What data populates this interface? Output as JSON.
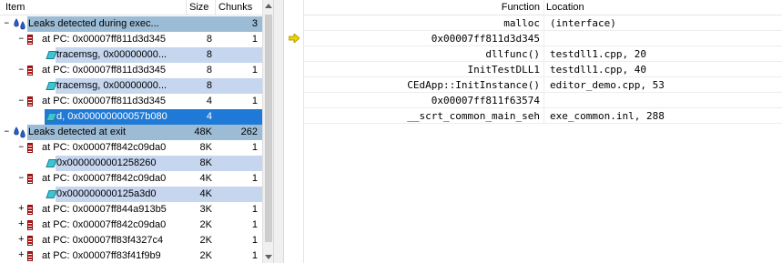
{
  "left_pane": {
    "headers": {
      "item": "Item",
      "size": "Size",
      "chunks": "Chunks"
    },
    "rows": [
      {
        "kind": "group",
        "expander": "–",
        "label": "Leaks detected during exec...",
        "size": "",
        "chunks": "3",
        "style": "group"
      },
      {
        "kind": "stack",
        "expander": "–",
        "label": "at PC: 0x00007ff811d3d345",
        "size": "8",
        "chunks": "1",
        "style": "plain"
      },
      {
        "kind": "block",
        "expander": "",
        "label": "tracemsg, 0x00000000...",
        "size": "8",
        "chunks": "",
        "style": "light"
      },
      {
        "kind": "stack",
        "expander": "–",
        "label": "at PC: 0x00007ff811d3d345",
        "size": "8",
        "chunks": "1",
        "style": "plain"
      },
      {
        "kind": "block",
        "expander": "",
        "label": "tracemsg, 0x00000000...",
        "size": "8",
        "chunks": "",
        "style": "light"
      },
      {
        "kind": "stack",
        "expander": "–",
        "label": "at PC: 0x00007ff811d3d345",
        "size": "4",
        "chunks": "1",
        "style": "plain"
      },
      {
        "kind": "block",
        "expander": "",
        "label": "d, 0x000000000057b080",
        "size": "4",
        "chunks": "",
        "style": "selected"
      },
      {
        "kind": "group",
        "expander": "–",
        "label": "Leaks detected at exit",
        "size": "48K",
        "chunks": "262",
        "style": "group"
      },
      {
        "kind": "stack",
        "expander": "–",
        "label": "at PC: 0x00007ff842c09da0",
        "size": "8K",
        "chunks": "1",
        "style": "plain"
      },
      {
        "kind": "block",
        "expander": "",
        "label": "0x0000000001258260",
        "size": "8K",
        "chunks": "",
        "style": "light"
      },
      {
        "kind": "stack",
        "expander": "–",
        "label": "at PC: 0x00007ff842c09da0",
        "size": "4K",
        "chunks": "1",
        "style": "plain"
      },
      {
        "kind": "block",
        "expander": "",
        "label": "0x000000000125a3d0",
        "size": "4K",
        "chunks": "",
        "style": "light"
      },
      {
        "kind": "stack",
        "expander": "+",
        "label": "at PC: 0x00007ff844a913b5",
        "size": "3K",
        "chunks": "1",
        "style": "plain"
      },
      {
        "kind": "stack",
        "expander": "+",
        "label": "at PC: 0x00007ff842c09da0",
        "size": "2K",
        "chunks": "1",
        "style": "plain"
      },
      {
        "kind": "stack",
        "expander": "+",
        "label": "at PC: 0x00007ff83f4327c4",
        "size": "2K",
        "chunks": "1",
        "style": "plain"
      },
      {
        "kind": "stack",
        "expander": "+",
        "label": "at PC: 0x00007ff83f41f9b9",
        "size": "2K",
        "chunks": "1",
        "style": "plain"
      }
    ]
  },
  "right_pane": {
    "headers": {
      "function": "Function",
      "location": "Location"
    },
    "rows": [
      {
        "function": "malloc",
        "location": "(interface)",
        "current": false
      },
      {
        "function": "0x00007ff811d3d345",
        "location": "",
        "current": true
      },
      {
        "function": "dllfunc()",
        "location": "testdll1.cpp, 20",
        "current": false
      },
      {
        "function": "InitTestDLL1",
        "location": "testdll1.cpp, 40",
        "current": false
      },
      {
        "function": "CEdApp::InitInstance()",
        "location": "editor_demo.cpp, 53",
        "current": false
      },
      {
        "function": "0x00007ff811f63574",
        "location": "",
        "current": false
      },
      {
        "function": "__scrt_common_main_seh",
        "location": "exe_common.inl, 288",
        "current": false
      }
    ]
  },
  "icons": {
    "group": "leak-group-icon",
    "stack": "call-stack-icon",
    "block": "memory-block-icon",
    "current_frame": "current-frame-arrow-icon"
  },
  "colors": {
    "group_bg": "#9cbcd6",
    "light_bg": "#c5d6ee",
    "selected_bg": "#1e7ad6",
    "selected_text": "#ffffff",
    "arrow": "#f0d200"
  }
}
